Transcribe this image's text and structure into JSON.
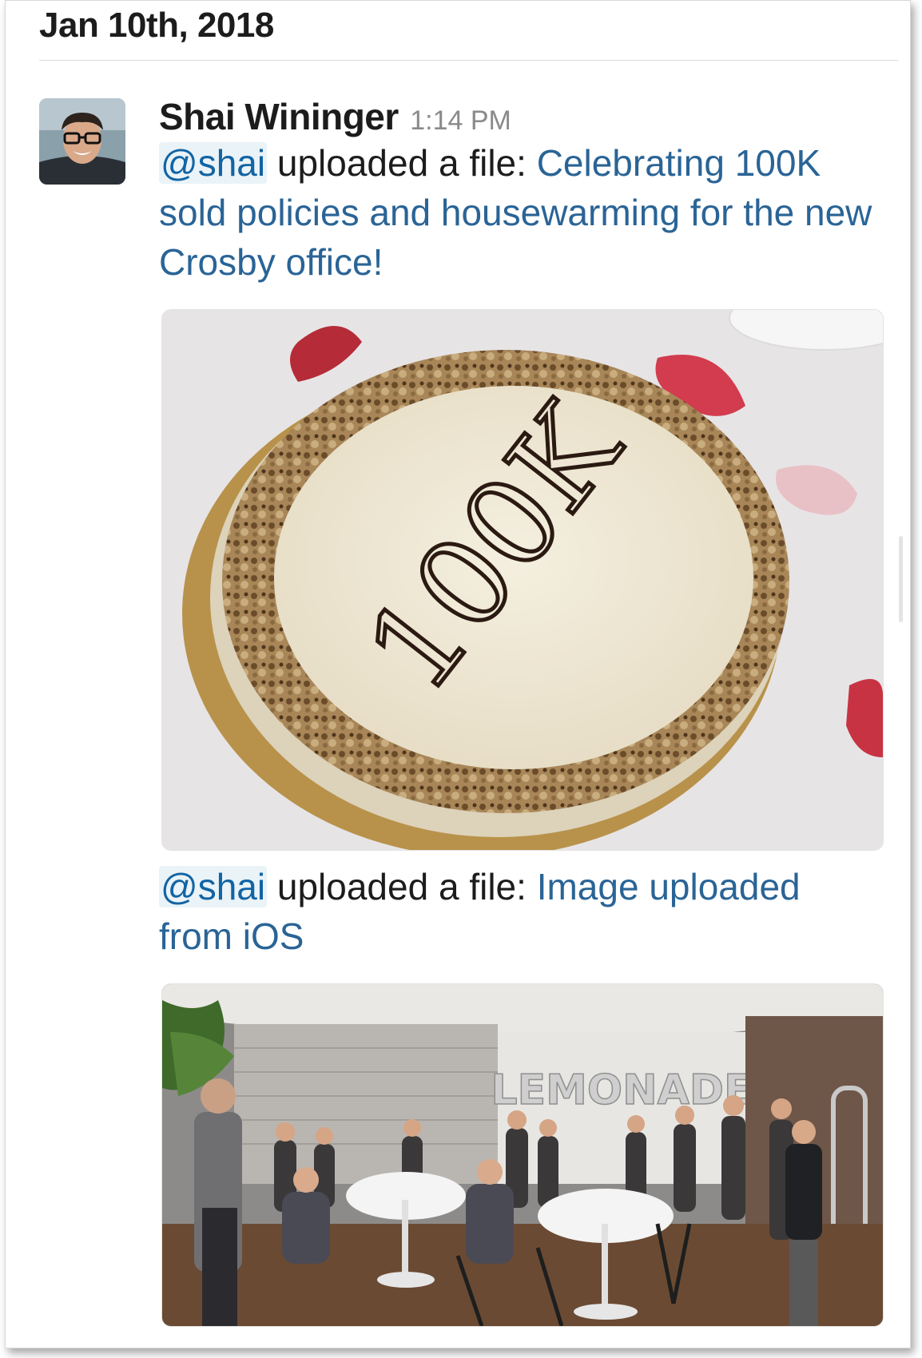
{
  "day_divider": {
    "date": "Jan 10th, 2018"
  },
  "message": {
    "sender": "Shai Wininger",
    "time": "1:14 PM",
    "avatar_icon": "user-avatar-photo",
    "uploads": [
      {
        "mention": "@shai",
        "action": " uploaded a file: ",
        "file_title": "Celebrating 100K sold policies and housewarming for the new Crosby office!",
        "image_icon": "cake-photo"
      },
      {
        "mention": "@shai",
        "action": " uploaded a file: ",
        "file_title": "Image uploaded from iOS",
        "image_icon": "office-party-photo"
      }
    ]
  },
  "photo_text": {
    "cake_writing": "100K",
    "wall_sign": "LEMONADE"
  },
  "colors": {
    "link": "#2a6496",
    "mention_bg": "#eaf3f8",
    "mention_text": "#1264a3",
    "timestamp": "#8a8a8a"
  }
}
